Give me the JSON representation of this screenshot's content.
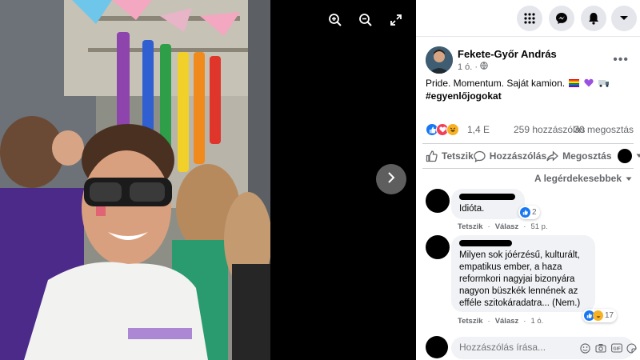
{
  "viewer": {
    "tools": [
      {
        "name": "zoom-in-icon"
      },
      {
        "name": "zoom-out-icon"
      },
      {
        "name": "fullscreen-icon"
      }
    ],
    "next_icon": "chevron-right-icon"
  },
  "topbar": {
    "icons": [
      "menu-grid-icon",
      "messenger-icon",
      "notifications-bell-icon",
      "account-dropdown-icon"
    ]
  },
  "post": {
    "author": "Fekete-Győr András",
    "time": "1 ó.",
    "privacy_icon": "public-globe-icon",
    "text": "Pride. Momentum. Saját kamion.",
    "hashtag": "#egyenlőjogokat",
    "reaction_count": "1,4 E",
    "comments_count": "259 hozzászólás",
    "shares_count": "30 megosztás",
    "colors": {
      "like": "#1877f2",
      "love": "#f33e58",
      "haha": "#f7b125"
    }
  },
  "actions": {
    "like": "Tetszik",
    "comment": "Hozzászólás",
    "share": "Megosztás"
  },
  "sort_label": "A legérdekesebbek",
  "comments": [
    {
      "text": "Idióta.",
      "like_label": "Tetszik",
      "reply_label": "Válasz",
      "time": "51 p.",
      "reactions": "2"
    },
    {
      "text": "Milyen sok jóérzésű, kulturált, empatikus ember, a haza reformkori nagyjai bizonyára nagyon büszkék lennének az efféle szitokáradatra... (Nem.)",
      "like_label": "Tetszik",
      "reply_label": "Válasz",
      "time": "1 ó.",
      "reactions": "17"
    }
  ],
  "composer": {
    "placeholder": "Hozzászólás írása..."
  }
}
